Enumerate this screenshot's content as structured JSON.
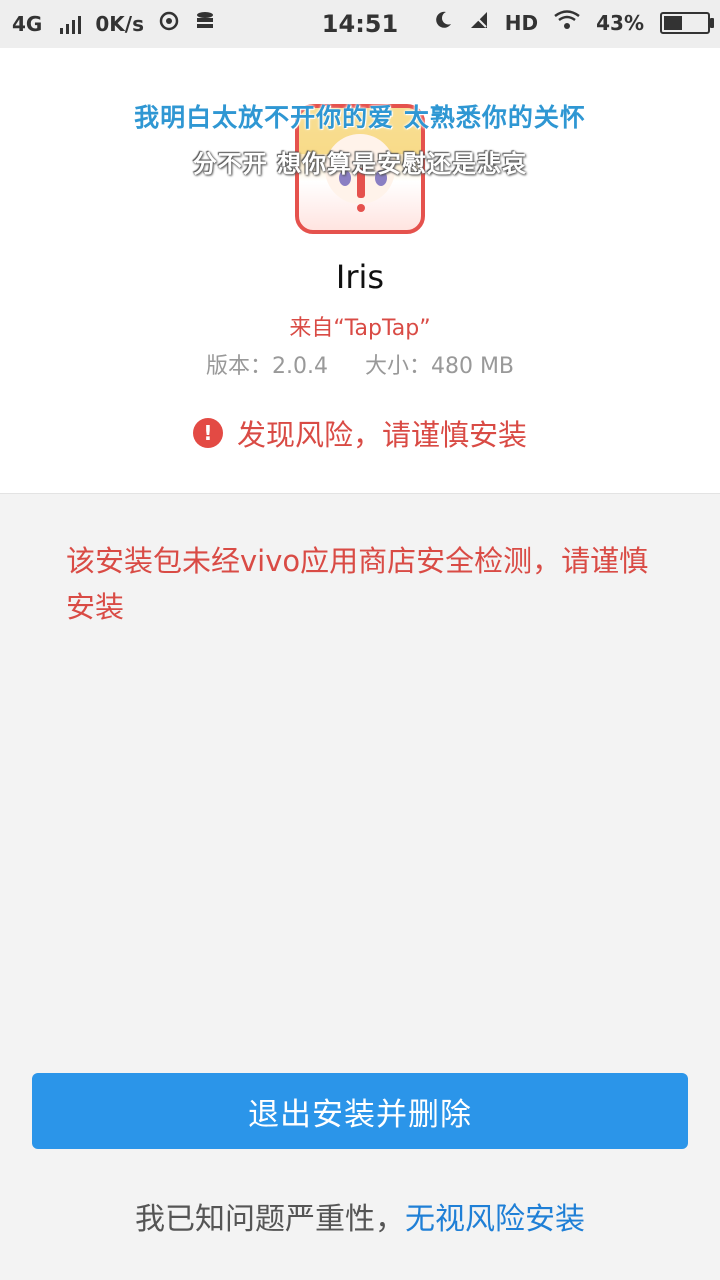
{
  "status_bar": {
    "network": "4G",
    "speed": "0K/s",
    "time": "14:51",
    "hd": "HD",
    "battery_percent": "43%",
    "battery_level": 0.43,
    "icons": [
      "signal-icon",
      "sync-icon",
      "data-icon",
      "moon-icon",
      "no-signal-icon",
      "wifi-icon",
      "battery-icon"
    ]
  },
  "overlay_lyrics": {
    "line1": "我明白太放不开你的爱 太熟悉你的关怀",
    "line2": "分不开 想你算是安慰还是悲哀"
  },
  "app": {
    "name": "Iris",
    "source": "来自“TapTap”",
    "version": "版本：2.0.4",
    "size": "大小：480 MB",
    "icon": "iris-app-icon"
  },
  "risk": {
    "icon": "!",
    "text": "发现风险，请谨慎安装"
  },
  "warning": {
    "message": "该安装包未经vivo应用商店安全检测，请谨慎安装"
  },
  "actions": {
    "exit_label": "退出安装并删除",
    "footer_prefix": "我已知问题严重性，",
    "ignore_link": "无视风险安装"
  },
  "colors": {
    "accent_blue": "#2b95e9",
    "warning_red": "#d94b45",
    "link_blue": "#1f7fd6"
  }
}
